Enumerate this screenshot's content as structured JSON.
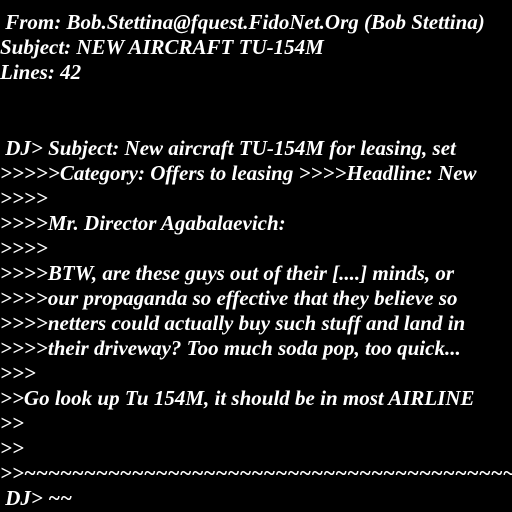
{
  "document": {
    "header": {
      "from": " From: Bob.Stettina@fquest.FidoNet.Org (Bob Stettina)",
      "subject": "Subject: NEW AIRCRAFT TU-154M",
      "lines": "Lines: 42"
    },
    "body": {
      "line_01": " DJ> Subject: New aircraft TU-154M for leasing, set",
      "line_02": ">>>>>Category: Offers to leasing >>>>Headline: New",
      "line_03": ">>>>",
      "line_04": ">>>>Mr. Director Agabalaevich:",
      "line_05": ">>>>",
      "line_06": ">>>>BTW, are these guys out of their [....] minds, or",
      "line_07": ">>>>our propaganda so effective that they believe so",
      "line_08": ">>>>netters could actually buy such stuff and land in",
      "line_09": ">>>>their driveway? Too much soda pop, too quick...",
      "line_10": ">>>",
      "line_11": ">>Go look up Tu 154M, it should be in most AIRLINE",
      "line_12": ">>",
      "line_13": ">>",
      "line_14": ">>~~~~~~~~~~~~~~~~~~~~~~~~~~~~~~~~~~~~~~~~~~~~~~~~~~~~~~~~~~~~~",
      "line_15": " DJ> ~~"
    }
  }
}
